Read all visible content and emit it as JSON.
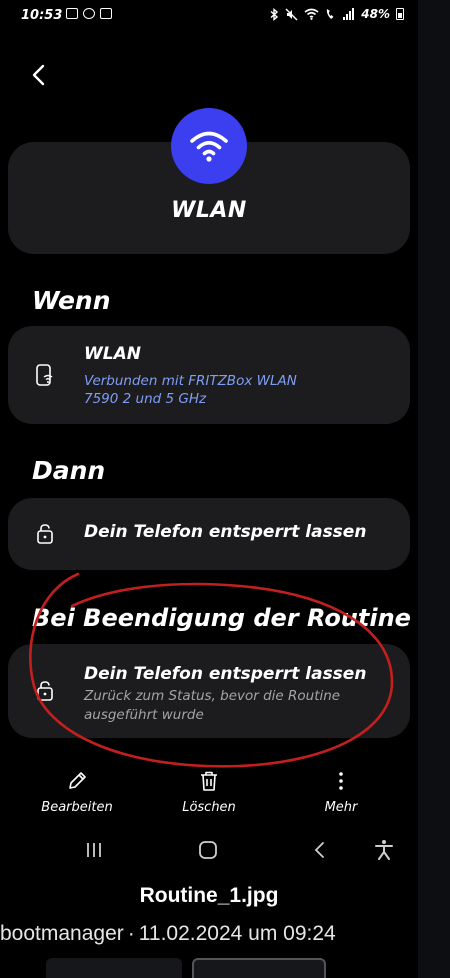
{
  "status_bar": {
    "time": "10:53",
    "battery": "48%"
  },
  "header": {
    "back_icon": "chevron-left-icon"
  },
  "routine": {
    "icon": "wifi-icon",
    "icon_color": "#3c3ff0",
    "title": "WLAN"
  },
  "if_section": {
    "heading": "Wenn",
    "card": {
      "icon": "phone-wifi-icon",
      "title": "WLAN",
      "subtitle_line1": "Verbunden mit FRITZBox WLAN",
      "subtitle_line2": "7590 2 und 5 GHz"
    }
  },
  "then_section": {
    "heading": "Dann",
    "card": {
      "icon": "lock-icon",
      "title": "Dein Telefon entsperrt lassen"
    }
  },
  "end_section": {
    "heading": "Bei Beendigung der Routine",
    "card": {
      "icon": "lock-icon",
      "title": "Dein Telefon entsperrt lassen",
      "subtitle_line1": "Zurück zum Status, bevor die Routine",
      "subtitle_line2": "ausgeführt wurde"
    }
  },
  "actions": [
    {
      "icon": "pencil-icon",
      "label": "Bearbeiten"
    },
    {
      "icon": "trash-icon",
      "label": "Löschen"
    },
    {
      "icon": "more-vertical-icon",
      "label": "Mehr"
    }
  ],
  "caption": {
    "filename": "Routine_1.jpg",
    "author": "bootmanager",
    "date": "11.02.2024 um 09:24"
  },
  "colors": {
    "card_bg": "#1c1c1e",
    "link_blue": "#7f9ef5",
    "annotation_red": "#c41f1f"
  }
}
